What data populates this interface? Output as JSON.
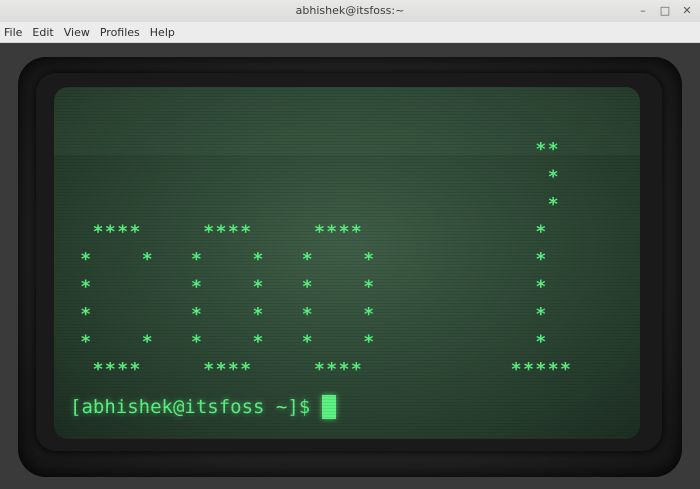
{
  "window": {
    "title": "abhishek@itsfoss:~",
    "minimize_glyph": "–",
    "maximize_glyph": "□",
    "close_glyph": "✕"
  },
  "menu": {
    "items": [
      {
        "label": "File"
      },
      {
        "label": "Edit"
      },
      {
        "label": "View"
      },
      {
        "label": "Profiles"
      },
      {
        "label": "Help"
      }
    ]
  },
  "terminal": {
    "ascii_art": {
      "word": "cool",
      "glyph": "*",
      "rows": [
        "                                      **",
        "                                       *",
        "                                       *",
        "  ****     ****     ****              *",
        " *    *   *    *   *    *             *",
        " *        *    *   *    *             *",
        " *        *    *   *    *             *",
        " *    *   *    *   *    *             *",
        "  ****     ****     ****            *****"
      ]
    },
    "prompt": "[abhishek@itsfoss ~]$",
    "text_color": "#5cf282",
    "screen_color": "#2f4a37"
  }
}
